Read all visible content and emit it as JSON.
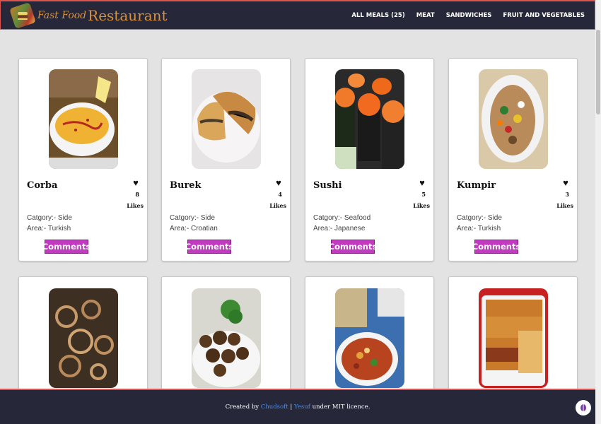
{
  "header": {
    "logo_fast": "Fast Food",
    "logo_restaurant": "Restaurant",
    "nav": [
      {
        "label": "ALL MEALS (25)"
      },
      {
        "label": "MEAT"
      },
      {
        "label": "SANDWICHES"
      },
      {
        "label": "FRUIT AND VEGETABLES"
      }
    ]
  },
  "meals": [
    {
      "name": "Corba",
      "likes": "8",
      "likes_label": "Likes",
      "category": "Catgory:- Side",
      "area": "Area:- Turkish",
      "comments_label": "Comments",
      "image_icon": "soup-photo"
    },
    {
      "name": "Burek",
      "likes": "4",
      "likes_label": "Likes",
      "category": "Catgory:- Side",
      "area": "Area:- Croatian",
      "comments_label": "Comments",
      "image_icon": "pastry-photo"
    },
    {
      "name": "Sushi",
      "likes": "5",
      "likes_label": "Likes",
      "category": "Catgory:- Seafood",
      "area": "Area:- Japanese",
      "comments_label": "Comments",
      "image_icon": "sushi-photo"
    },
    {
      "name": "Kumpir",
      "likes": "3",
      "likes_label": "Likes",
      "category": "Catgory:- Side",
      "area": "Area:- Turkish",
      "comments_label": "Comments",
      "image_icon": "potato-photo"
    },
    {
      "image_icon": "onion-meat-photo"
    },
    {
      "image_icon": "falafel-photo"
    },
    {
      "image_icon": "stew-photo"
    },
    {
      "image_icon": "lasagne-photo"
    }
  ],
  "footer": {
    "prefix": "Created by",
    "author1": "Chudsoft",
    "separator": "|",
    "author2": "Yesuf",
    "suffix": "under MIT licence."
  }
}
